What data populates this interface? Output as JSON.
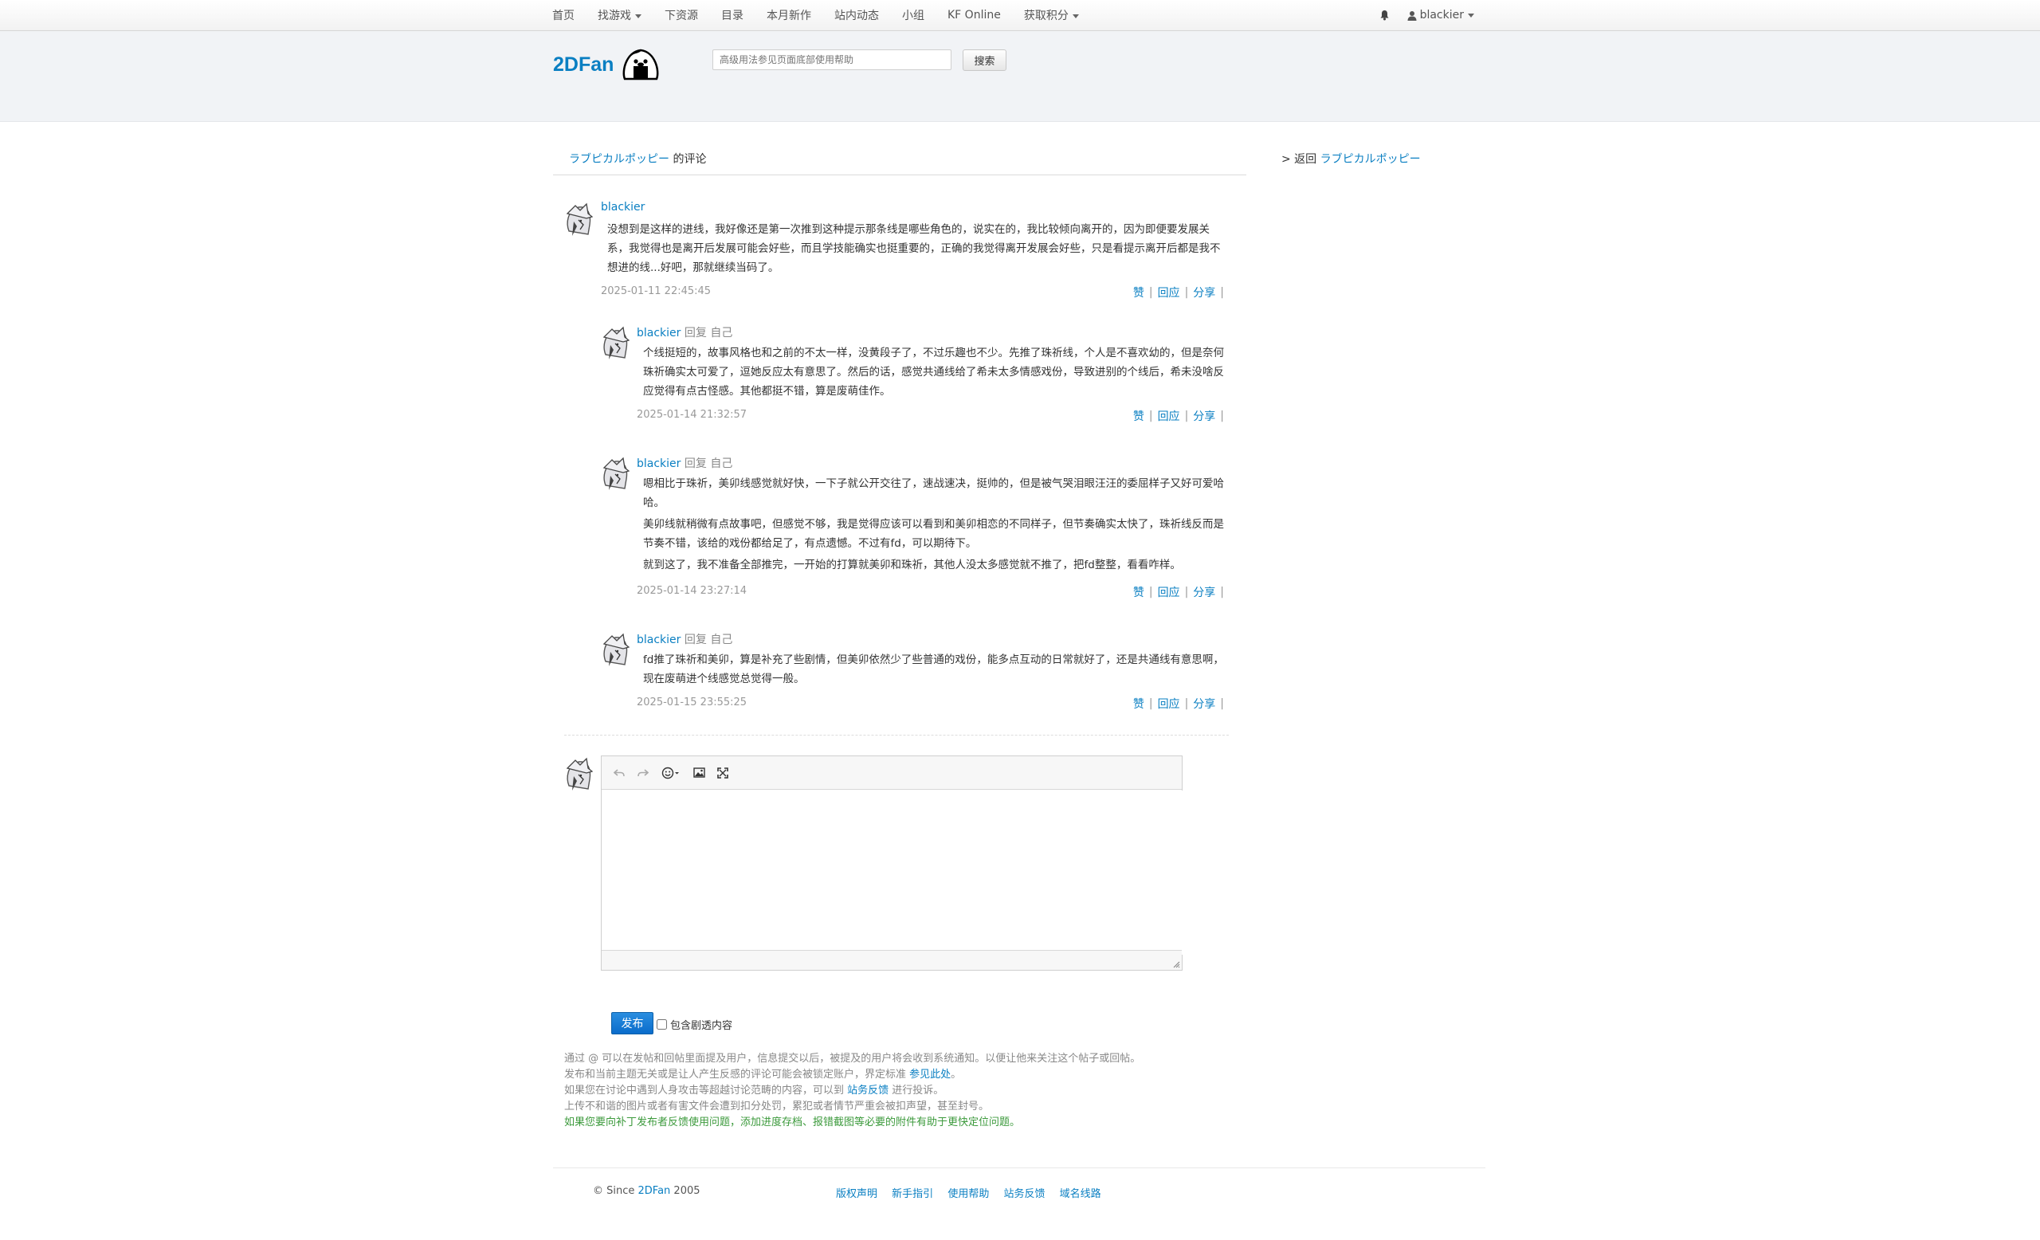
{
  "navbar": {
    "items": [
      {
        "label": "首页",
        "caret": false
      },
      {
        "label": "找游戏",
        "caret": true
      },
      {
        "label": "下资源",
        "caret": false
      },
      {
        "label": "目录",
        "caret": false
      },
      {
        "label": "本月新作",
        "caret": false
      },
      {
        "label": "站内动态",
        "caret": false
      },
      {
        "label": "小组",
        "caret": false
      },
      {
        "label": "KF Online",
        "caret": false
      },
      {
        "label": "获取积分",
        "caret": true
      }
    ],
    "bell_icon": "bell-icon",
    "user_icon": "user-icon",
    "username": "blackier"
  },
  "header": {
    "logo": "2DFan",
    "search_placeholder": "高级用法参见页面底部使用帮助",
    "search_button": "搜索"
  },
  "page": {
    "title_link": "ラブピカルポッピー",
    "title_suffix": " 的评论",
    "side_back_prefix": "> 返回 ",
    "side_back_link": "ラブピカルポッピー"
  },
  "labels": {
    "reply_word": "回复",
    "self_word": "自己",
    "like": "赞",
    "reply": "回应",
    "share": "分享"
  },
  "comments": [
    {
      "user": "blackier",
      "paragraphs": [
        "没想到是这样的进线，我好像还是第一次推到这种提示那条线是哪些角色的，说实在的，我比较倾向离开的，因为即便要发展关系，我觉得也是离开后发展可能会好些，而且学技能确实也挺重要的，正确的我觉得离开发展会好些，只是看提示离开后都是我不想进的线...好吧，那就继续当码了。"
      ],
      "time": "2025-01-11 22:45:45"
    },
    {
      "user": "blackier",
      "paragraphs": [
        "个线挺短的，故事风格也和之前的不太一样，没黄段子了，不过乐趣也不少。先推了珠祈线，个人是不喜欢幼的，但是奈何珠祈确实太可爱了，逗她反应太有意思了。然后的话，感觉共通线给了希未太多情感戏份，导致进别的个线后，希未没啥反应觉得有点古怪感。其他都挺不错，算是废萌佳作。"
      ],
      "time": "2025-01-14 21:32:57"
    },
    {
      "user": "blackier",
      "paragraphs": [
        "嗯相比于珠祈，美卯线感觉就好快，一下子就公开交往了，速战速决，挺帅的，但是被气哭泪眼汪汪的委屈样子又好可爱哈哈。",
        "美卯线就稍微有点故事吧，但感觉不够，我是觉得应该可以看到和美卯相恋的不同样子，但节奏确实太快了，珠祈线反而是节奏不错，该给的戏份都给足了，有点遗憾。不过有fd，可以期待下。",
        "就到这了，我不准备全部推完，一开始的打算就美卯和珠祈，其他人没太多感觉就不推了，把fd整整，看看咋样。"
      ],
      "time": "2025-01-14 23:27:14"
    },
    {
      "user": "blackier",
      "paragraphs": [
        "fd推了珠祈和美卯，算是补充了些剧情，但美卯依然少了些普通的戏份，能多点互动的日常就好了，还是共通线有意思啊，现在废萌进个线感觉总觉得一般。"
      ],
      "time": "2025-01-15 23:55:25"
    }
  ],
  "editor": {
    "undo_icon": "undo-icon",
    "redo_icon": "redo-icon",
    "emoji_icon": "emoji-icon",
    "image_icon": "image-icon",
    "fullscreen_icon": "fullscreen-icon",
    "publish": "发布",
    "spoiler_label": "包含剧透内容"
  },
  "notes": {
    "line1": "通过 @ 可以在发帖和回帖里面提及用户，信息提交以后，被提及的用户将会收到系统通知。以便让他来关注这个帖子或回帖。",
    "line2_text": "发布和当前主题无关或是让人产生反感的评论可能会被锁定账户，界定标准 ",
    "line2_link": "参见此处",
    "line2_end": "。",
    "line3_text": "如果您在讨论中遇到人身攻击等超越讨论范畴的内容，可以到 ",
    "line3_link": "站务反馈",
    "line3_end": " 进行投诉。",
    "line4": "上传不和谐的图片或者有害文件会遭到扣分处罚，累犯或者情节严重会被扣声望，甚至封号。",
    "line5": "如果您要向补丁发布者反馈使用问题，添加进度存档、报错截图等必要的附件有助于更快定位问题。"
  },
  "footer": {
    "since_prefix": "© Since ",
    "since_link": "2DFan",
    "since_year": " 2005",
    "links": [
      "版权声明",
      "新手指引",
      "使用帮助",
      "站务反馈",
      "域名线路"
    ]
  },
  "colors": {
    "link": "#0a7fc2",
    "publish": "#0a6ccb",
    "header_bg": "#f1f3f6",
    "note_green": "#3c9a3c"
  }
}
